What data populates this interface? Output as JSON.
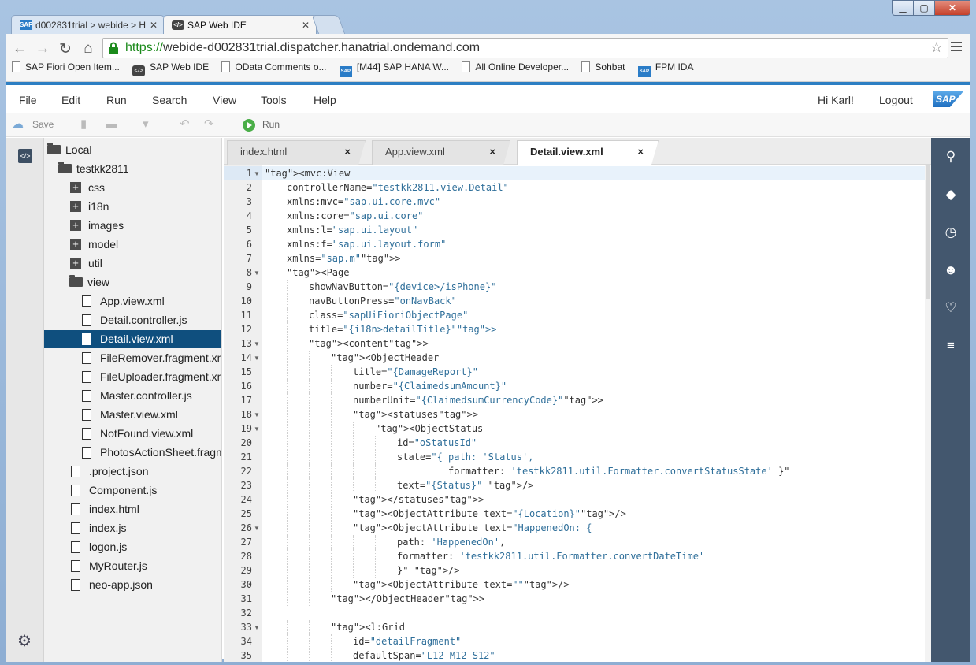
{
  "browser": {
    "tabs": [
      {
        "label": "d002831trial > webide > H",
        "icon": "sap-icon"
      },
      {
        "label": "SAP Web IDE",
        "icon": "webide-icon"
      }
    ],
    "url_scheme": "https://",
    "url_host": "webide-d002831trial.dispatcher.hanatrial.ondemand.com",
    "bookmarks": [
      {
        "label": "SAP Fiori Open Item...",
        "icon": "page"
      },
      {
        "label": "SAP Web IDE",
        "icon": "ide"
      },
      {
        "label": "OData Comments o...",
        "icon": "page"
      },
      {
        "label": "[M44] SAP HANA W...",
        "icon": "sap"
      },
      {
        "label": "All Online Developer...",
        "icon": "page"
      },
      {
        "label": "Sohbat",
        "icon": "page"
      },
      {
        "label": "FPM IDA",
        "icon": "sap"
      }
    ]
  },
  "menu": {
    "items": [
      "File",
      "Edit",
      "Run",
      "Search",
      "View",
      "Tools",
      "Help"
    ],
    "greeting": "Hi Karl!",
    "logout": "Logout",
    "logo": "SAP"
  },
  "toolbar": {
    "save": "Save",
    "run": "Run"
  },
  "tree": {
    "root": "Local",
    "project": "testkk2811",
    "folders": [
      "css",
      "i18n",
      "images",
      "model",
      "util"
    ],
    "view_folder": "view",
    "view_files": [
      "App.view.xml",
      "Detail.controller.js",
      "Detail.view.xml",
      "FileRemover.fragment.xml",
      "FileUploader.fragment.xml",
      "Master.controller.js",
      "Master.view.xml",
      "NotFound.view.xml",
      "PhotosActionSheet.fragment.xml"
    ],
    "root_files": [
      ".project.json",
      "Component.js",
      "index.html",
      "index.js",
      "logon.js",
      "MyRouter.js",
      "neo-app.json"
    ],
    "selected": "Detail.view.xml"
  },
  "editor": {
    "tabs": [
      {
        "label": "index.html",
        "active": false
      },
      {
        "label": "App.view.xml",
        "active": false
      },
      {
        "label": "Detail.view.xml",
        "active": true
      }
    ],
    "close_glyph": "×",
    "active_line": 1,
    "lines": [
      {
        "n": "1",
        "fold": true,
        "indent": 0,
        "text": "<mvc:View"
      },
      {
        "n": "2",
        "fold": false,
        "indent": 1,
        "text": "controllerName=\"testkk2811.view.Detail\""
      },
      {
        "n": "3",
        "fold": false,
        "indent": 1,
        "text": "xmlns:mvc=\"sap.ui.core.mvc\""
      },
      {
        "n": "4",
        "fold": false,
        "indent": 1,
        "text": "xmlns:core=\"sap.ui.core\""
      },
      {
        "n": "5",
        "fold": false,
        "indent": 1,
        "text": "xmlns:l=\"sap.ui.layout\""
      },
      {
        "n": "6",
        "fold": false,
        "indent": 1,
        "text": "xmlns:f=\"sap.ui.layout.form\""
      },
      {
        "n": "7",
        "fold": false,
        "indent": 1,
        "text": "xmlns=\"sap.m\">"
      },
      {
        "n": "8",
        "fold": true,
        "indent": 1,
        "text": "<Page"
      },
      {
        "n": "9",
        "fold": false,
        "indent": 2,
        "text": "showNavButton=\"{device>/isPhone}\""
      },
      {
        "n": "10",
        "fold": false,
        "indent": 2,
        "text": "navButtonPress=\"onNavBack\""
      },
      {
        "n": "11",
        "fold": false,
        "indent": 2,
        "text": "class=\"sapUiFioriObjectPage\""
      },
      {
        "n": "12",
        "fold": false,
        "indent": 2,
        "text": "title=\"{i18n>detailTitle}\">"
      },
      {
        "n": "13",
        "fold": true,
        "indent": 2,
        "text": "<content>"
      },
      {
        "n": "14",
        "fold": true,
        "indent": 3,
        "text": "<ObjectHeader"
      },
      {
        "n": "15",
        "fold": false,
        "indent": 4,
        "text": "title=\"{DamageReport}\""
      },
      {
        "n": "16",
        "fold": false,
        "indent": 4,
        "text": "number=\"{ClaimedsumAmount}\""
      },
      {
        "n": "17",
        "fold": false,
        "indent": 4,
        "text": "numberUnit=\"{ClaimedsumCurrencyCode}\">"
      },
      {
        "n": "18",
        "fold": true,
        "indent": 4,
        "text": "<statuses>"
      },
      {
        "n": "19",
        "fold": true,
        "indent": 5,
        "text": "<ObjectStatus"
      },
      {
        "n": "20",
        "fold": false,
        "indent": 6,
        "text": "id=\"oStatusId\""
      },
      {
        "n": "21",
        "fold": false,
        "indent": 6,
        "text": "state=\"{ path: 'Status',"
      },
      {
        "n": "22",
        "fold": false,
        "indent": 6,
        "text": "         formatter: 'testkk2811.util.Formatter.convertStatusState' }\""
      },
      {
        "n": "23",
        "fold": false,
        "indent": 6,
        "text": "text=\"{Status}\" />"
      },
      {
        "n": "24",
        "fold": false,
        "indent": 4,
        "text": "</statuses>"
      },
      {
        "n": "25",
        "fold": false,
        "indent": 4,
        "text": "<ObjectAttribute text=\"{Location}\"/>"
      },
      {
        "n": "26",
        "fold": true,
        "indent": 4,
        "text": "<ObjectAttribute text=\"HappenedOn: {"
      },
      {
        "n": "27",
        "fold": false,
        "indent": 6,
        "text": "path: 'HappenedOn',"
      },
      {
        "n": "28",
        "fold": false,
        "indent": 6,
        "text": "formatter: 'testkk2811.util.Formatter.convertDateTime'"
      },
      {
        "n": "29",
        "fold": false,
        "indent": 6,
        "text": "}\" />"
      },
      {
        "n": "30",
        "fold": false,
        "indent": 4,
        "text": "<ObjectAttribute text=\"\"/>"
      },
      {
        "n": "31",
        "fold": false,
        "indent": 3,
        "text": "</ObjectHeader>"
      },
      {
        "n": "32",
        "fold": false,
        "indent": 0,
        "text": ""
      },
      {
        "n": "33",
        "fold": true,
        "indent": 3,
        "text": "<l:Grid"
      },
      {
        "n": "34",
        "fold": false,
        "indent": 4,
        "text": "id=\"detailFragment\""
      },
      {
        "n": "35",
        "fold": false,
        "indent": 4,
        "text": "defaultSpan=\"L12 M12 S12\""
      }
    ]
  },
  "colors": {
    "accent": "#2d7fc3",
    "selected": "#0f4f7e",
    "rail": "#43576e",
    "tag": "#b73f8c",
    "string": "#2f6f9a"
  }
}
